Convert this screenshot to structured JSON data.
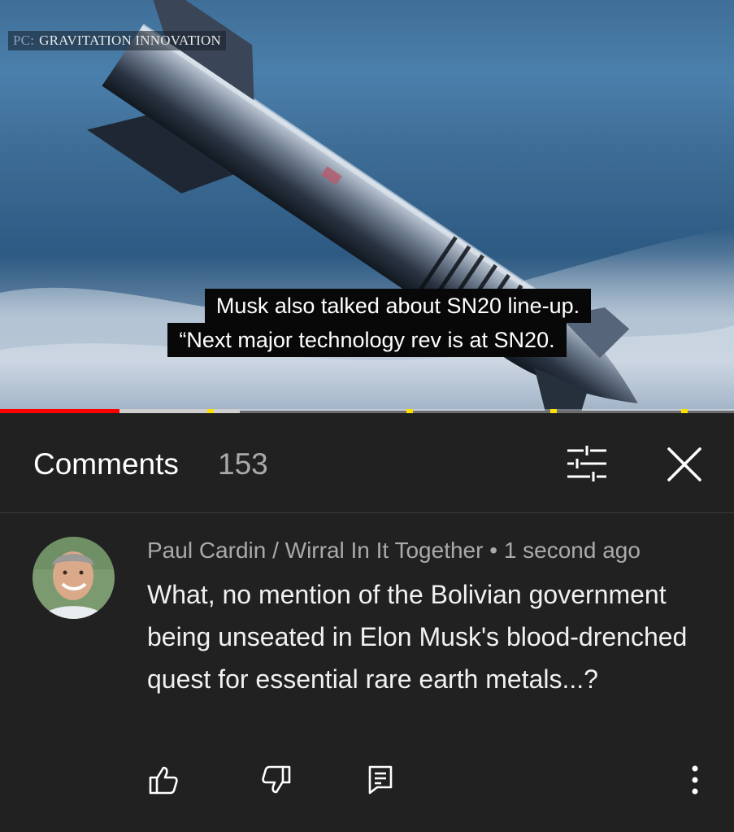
{
  "video": {
    "watermark_prefix": "PC:",
    "watermark_text": "GRAVITATION INNOVATION",
    "caption_line1": "Musk also talked about SN20 line-up.",
    "caption_line2": "“Next major technology rev is at SN20.",
    "progress_played_fraction": 0.163,
    "progress_buffered_fraction": 0.327
  },
  "comments_panel": {
    "title": "Comments",
    "count": "153",
    "filter_icon": "filter-sliders-icon",
    "close_icon": "close-x-icon"
  },
  "comment": {
    "author": "Paul Cardin / Wirral In It Together",
    "separator": "•",
    "time": "1 second ago",
    "text": "What, no mention of the Bolivian government being unseated in Elon Musk's blood-drenched quest for essential rare earth metals...?",
    "actions": [
      "thumb-up-icon",
      "thumb-down-icon",
      "reply-icon",
      "more-vertical-icon"
    ]
  },
  "colors": {
    "background": "#212121",
    "progress_played": "#ff0000",
    "text_primary": "#f1f1f1",
    "text_secondary": "#aaaaaa"
  }
}
